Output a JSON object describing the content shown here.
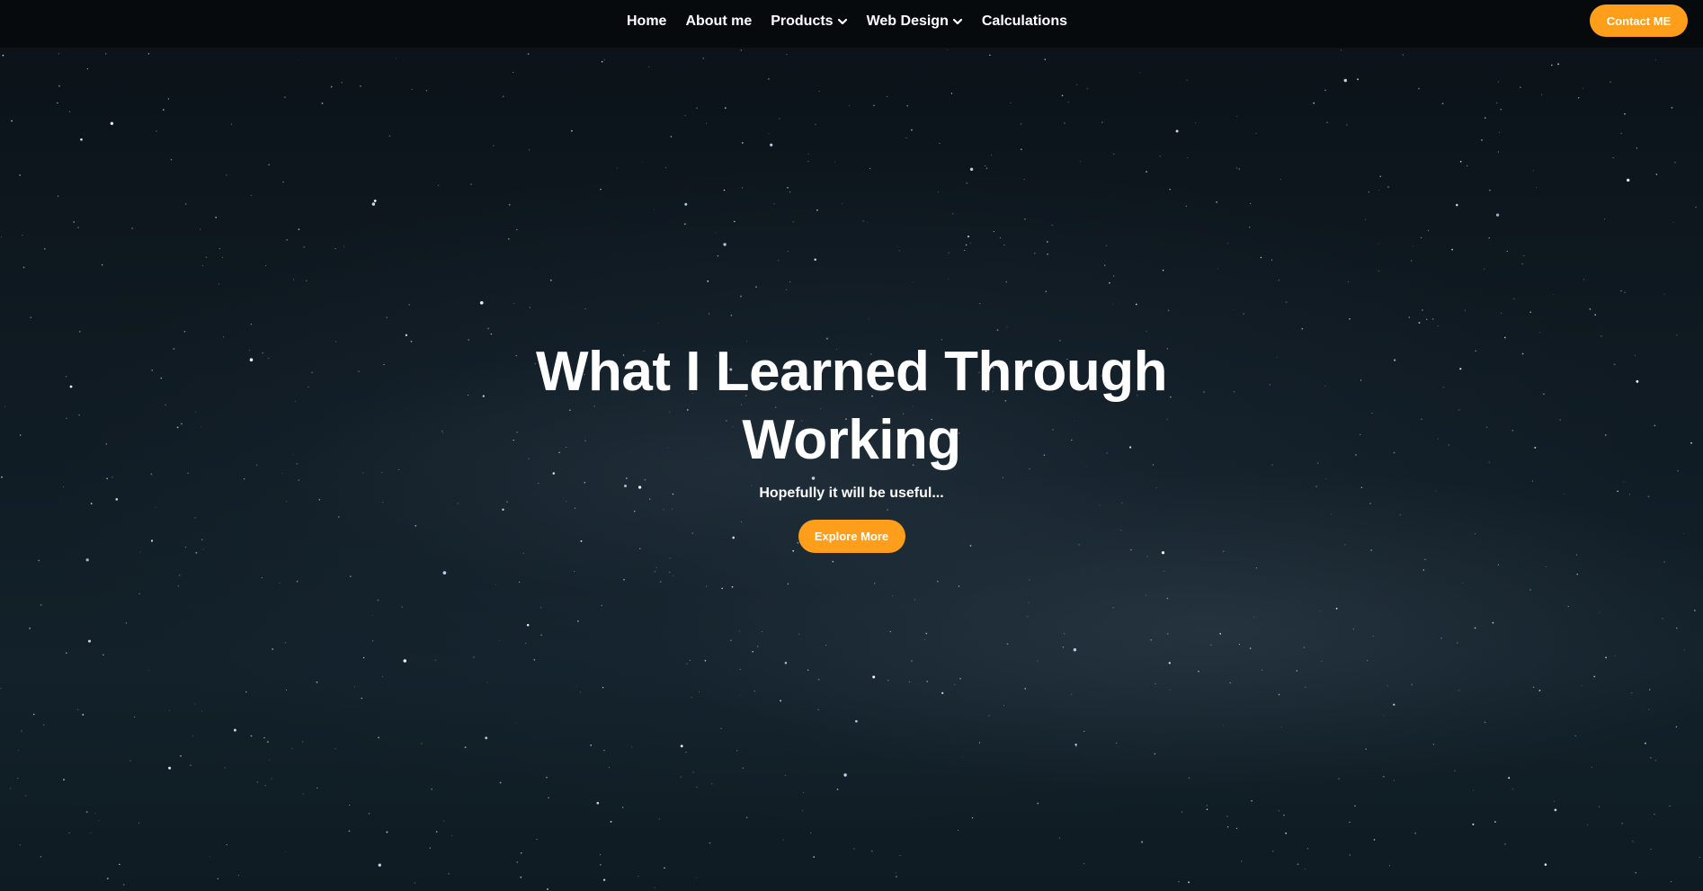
{
  "nav": {
    "items": [
      {
        "label": "Home",
        "has_dropdown": false
      },
      {
        "label": "About me",
        "has_dropdown": false
      },
      {
        "label": "Products",
        "has_dropdown": true
      },
      {
        "label": "Web Design",
        "has_dropdown": true
      },
      {
        "label": "Calculations",
        "has_dropdown": false
      }
    ],
    "contact_label": "Contact ME"
  },
  "hero": {
    "title": "What I Learned Through Working",
    "subtitle": "Hopefully it will be useful...",
    "cta_label": "Explore More"
  },
  "colors": {
    "accent": "#ff9e1b",
    "navbar_bg": "#080a0c",
    "sky_bg": "#0f1b22",
    "text": "#ffffff"
  },
  "icons": {
    "dropdown": "chevron-down-icon"
  }
}
